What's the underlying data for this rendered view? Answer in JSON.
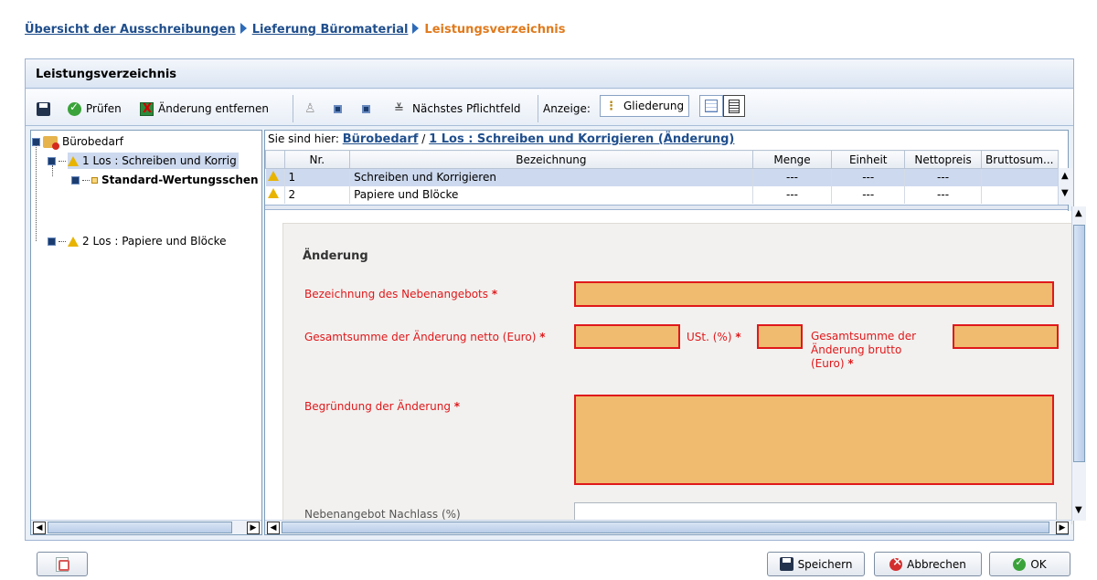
{
  "breadcrumb": {
    "items": [
      "Übersicht der Ausschreibungen",
      "Lieferung Büromaterial"
    ],
    "current": "Leistungsverzeichnis"
  },
  "window": {
    "title": "Leistungsverzeichnis"
  },
  "toolbar": {
    "pruefen": "Prüfen",
    "aenderung_entfernen": "Änderung entfernen",
    "naechstes_pflichtfeld": "Nächstes Pflichtfeld",
    "anzeige": "Anzeige:",
    "gliederung": "Gliederung"
  },
  "tree": {
    "root": "Bürobedarf",
    "items": [
      {
        "label": "1 Los : Schreiben und Korrig",
        "selected": true
      },
      {
        "label": "Standard-Wertungsschen"
      },
      {
        "label": "2 Los : Papiere und Blöcke"
      }
    ]
  },
  "location": {
    "prefix": "Sie sind hier:",
    "root": "Bürobedarf",
    "current": "1 Los : Schreiben und Korrigieren (Änderung)"
  },
  "table": {
    "columns": [
      "Nr.",
      "Bezeichnung",
      "Menge",
      "Einheit",
      "Nettopreis",
      "Bruttosum..."
    ],
    "rows": [
      {
        "nr": "1",
        "bezeichnung": "Schreiben und Korrigieren",
        "menge": "---",
        "einheit": "---",
        "nettopreis": "---",
        "bruttosumme": ""
      },
      {
        "nr": "2",
        "bezeichnung": "Papiere und Blöcke",
        "menge": "---",
        "einheit": "---",
        "nettopreis": "---",
        "bruttosumme": ""
      }
    ]
  },
  "form": {
    "section_title": "Änderung",
    "bezeichnung_label": "Bezeichnung des Nebenangebots",
    "netto_label": "Gesamtsumme der Änderung netto (Euro)",
    "ust_label": "USt. (%)",
    "brutto_label_1": "Gesamtsumme der",
    "brutto_label_2": "Änderung brutto",
    "brutto_label_3": "(Euro)",
    "begruendung_label": "Begründung der Änderung",
    "nachlass_label": "Nebenangebot Nachlass (%)",
    "required_marker": "*"
  },
  "buttons": {
    "speichern": "Speichern",
    "abbrechen": "Abbrechen",
    "ok": "OK"
  },
  "colors": {
    "link": "#1f4e8c",
    "breadcrumb_current": "#e07a1d",
    "required_label": "#e0181b",
    "required_field_fill": "#f0bb6e",
    "selection": "#cdd9ee"
  }
}
